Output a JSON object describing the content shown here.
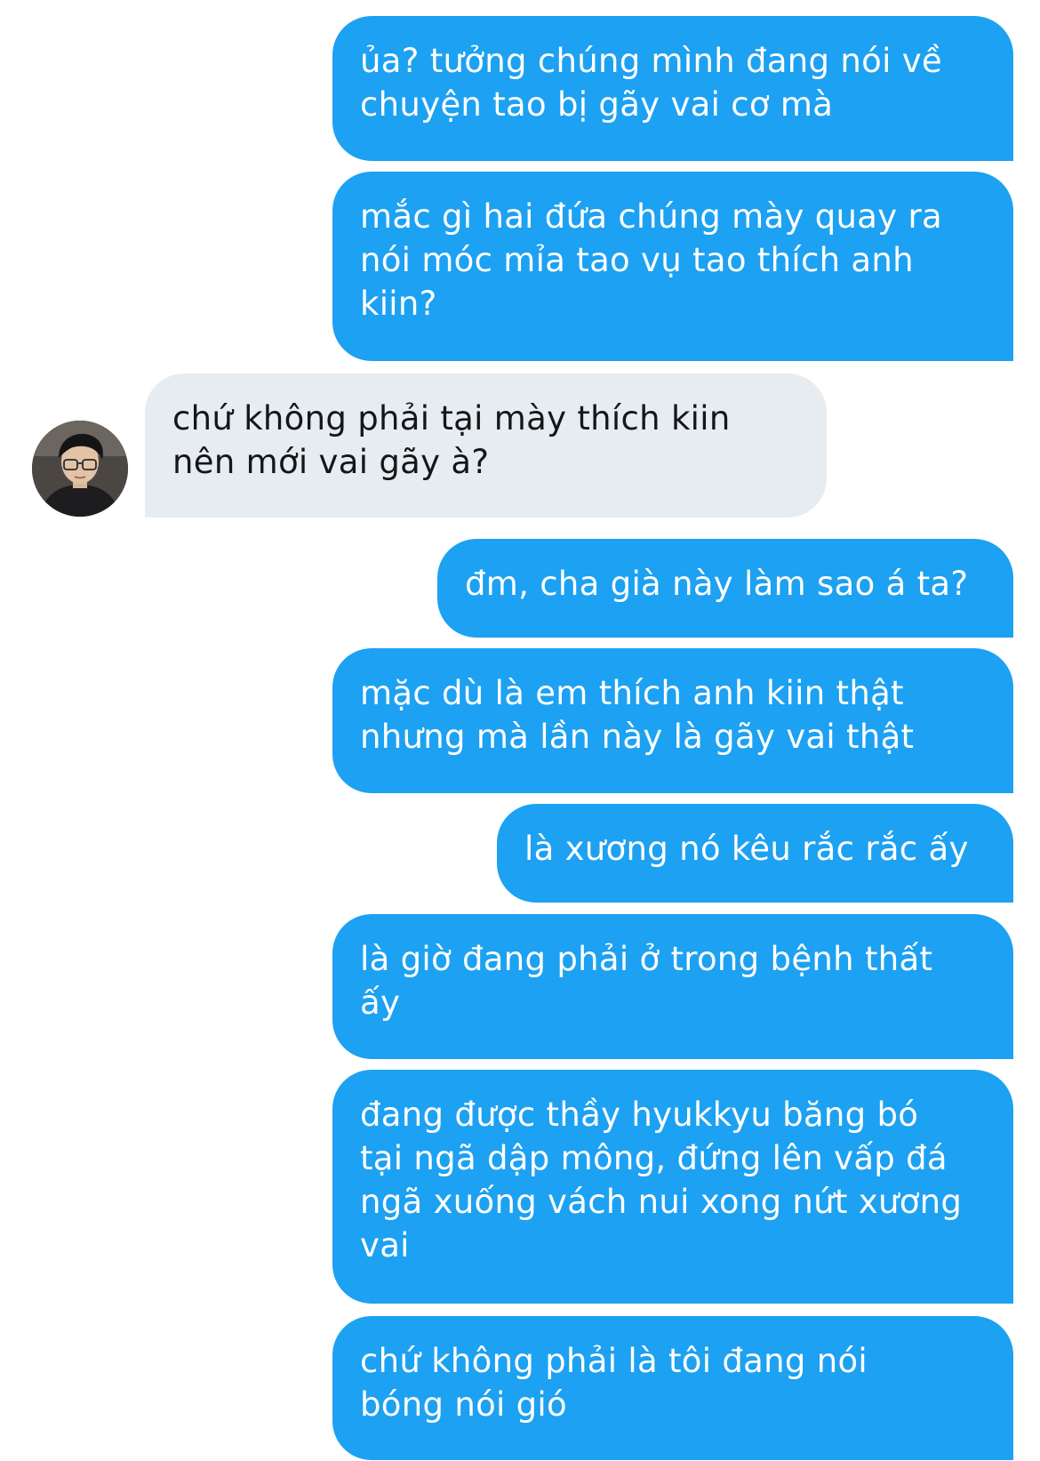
{
  "conversation": {
    "messages": [
      {
        "sender": "self",
        "text": "ủa? tưởng chúng mình đang nói về\nchuyện tao bị gãy vai cơ mà"
      },
      {
        "sender": "self",
        "text": "mắc gì hai đứa chúng mày quay ra\nnói móc mỉa tao vụ tao thích anh\nkiin?"
      },
      {
        "sender": "other",
        "text": "chứ không phải tại mày thích kiin\nnên mới vai gãy à?"
      },
      {
        "sender": "self",
        "text": "đm, cha già này làm sao á ta?"
      },
      {
        "sender": "self",
        "text": "mặc dù là em thích anh kiin thật\nnhưng mà lần này là gãy vai thật"
      },
      {
        "sender": "self",
        "text": "là xương nó kêu rắc rắc ấy"
      },
      {
        "sender": "self",
        "text": "là giờ đang phải ở trong bệnh thất\nấy"
      },
      {
        "sender": "self",
        "text": "đang được thầy hyukkyu băng bó\ntại ngã dập mông, đứng lên vấp đá\nngã xuống vách nui xong nứt xương\nvai"
      },
      {
        "sender": "self",
        "text": "chứ không phải là tôi đang nói\nbóng nói gió"
      }
    ]
  },
  "colors": {
    "outgoing_bubble": "#1da1f2",
    "incoming_bubble": "#e7ecf0",
    "outgoing_text": "#ffffff",
    "incoming_text": "#14171a"
  },
  "avatar": {
    "icon": "contact-avatar-icon"
  }
}
